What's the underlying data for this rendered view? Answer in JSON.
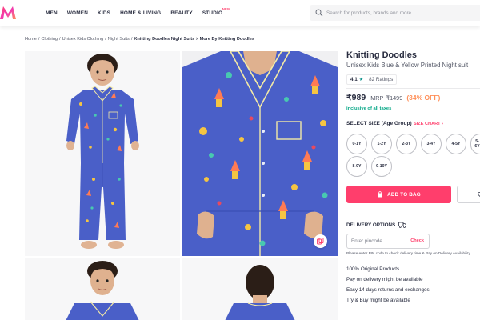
{
  "header": {
    "nav": [
      {
        "label": "MEN"
      },
      {
        "label": "WOMEN"
      },
      {
        "label": "KIDS"
      },
      {
        "label": "HOME & LIVING"
      },
      {
        "label": "BEAUTY"
      },
      {
        "label": "STUDIO",
        "badge": "NEW"
      }
    ],
    "search_placeholder": "Search for products, brands and more"
  },
  "breadcrumb": [
    "Home",
    "Clothing",
    "Unisex Kids Clothing",
    "Night Suits"
  ],
  "breadcrumb_current": "Knitting Doodles Night Suits > More By Knitting Doodles",
  "product": {
    "brand": "Knitting Doodles",
    "name": "Unisex Kids Blue & Yellow Printed Night suit",
    "rating": "4.1",
    "rating_star": "★",
    "ratings_count": "82 Ratings",
    "price": "₹989",
    "mrp_label": "MRP",
    "mrp": "₹1499",
    "discount": "(34% OFF)",
    "tax_note": "inclusive of all taxes"
  },
  "size": {
    "heading": "SELECT SIZE (Age Group)",
    "chart_link": "SIZE CHART ›",
    "options": [
      "0-1Y",
      "1-2Y",
      "2-3Y",
      "3-4Y",
      "4-5Y",
      "5-6Y",
      "8-9Y",
      "9-10Y"
    ]
  },
  "actions": {
    "add_to_bag": "ADD TO BAG"
  },
  "delivery": {
    "heading": "DELIVERY OPTIONS",
    "pincode_placeholder": "Enter pincode",
    "check_label": "Check",
    "note": "Please enter PIN code to check delivery time & Pay on Delivery Availability",
    "features": [
      "100% Original Products",
      "Pay on delivery might be available",
      "Easy 14 days returns and exchanges",
      "Try & Buy might be available"
    ]
  },
  "colors": {
    "brand_pink": "#ff3f6c",
    "discount_orange": "#ff905a",
    "tax_green": "#03a685",
    "rating_teal": "#14958f",
    "pajama_blue": "#4a5fc8"
  }
}
